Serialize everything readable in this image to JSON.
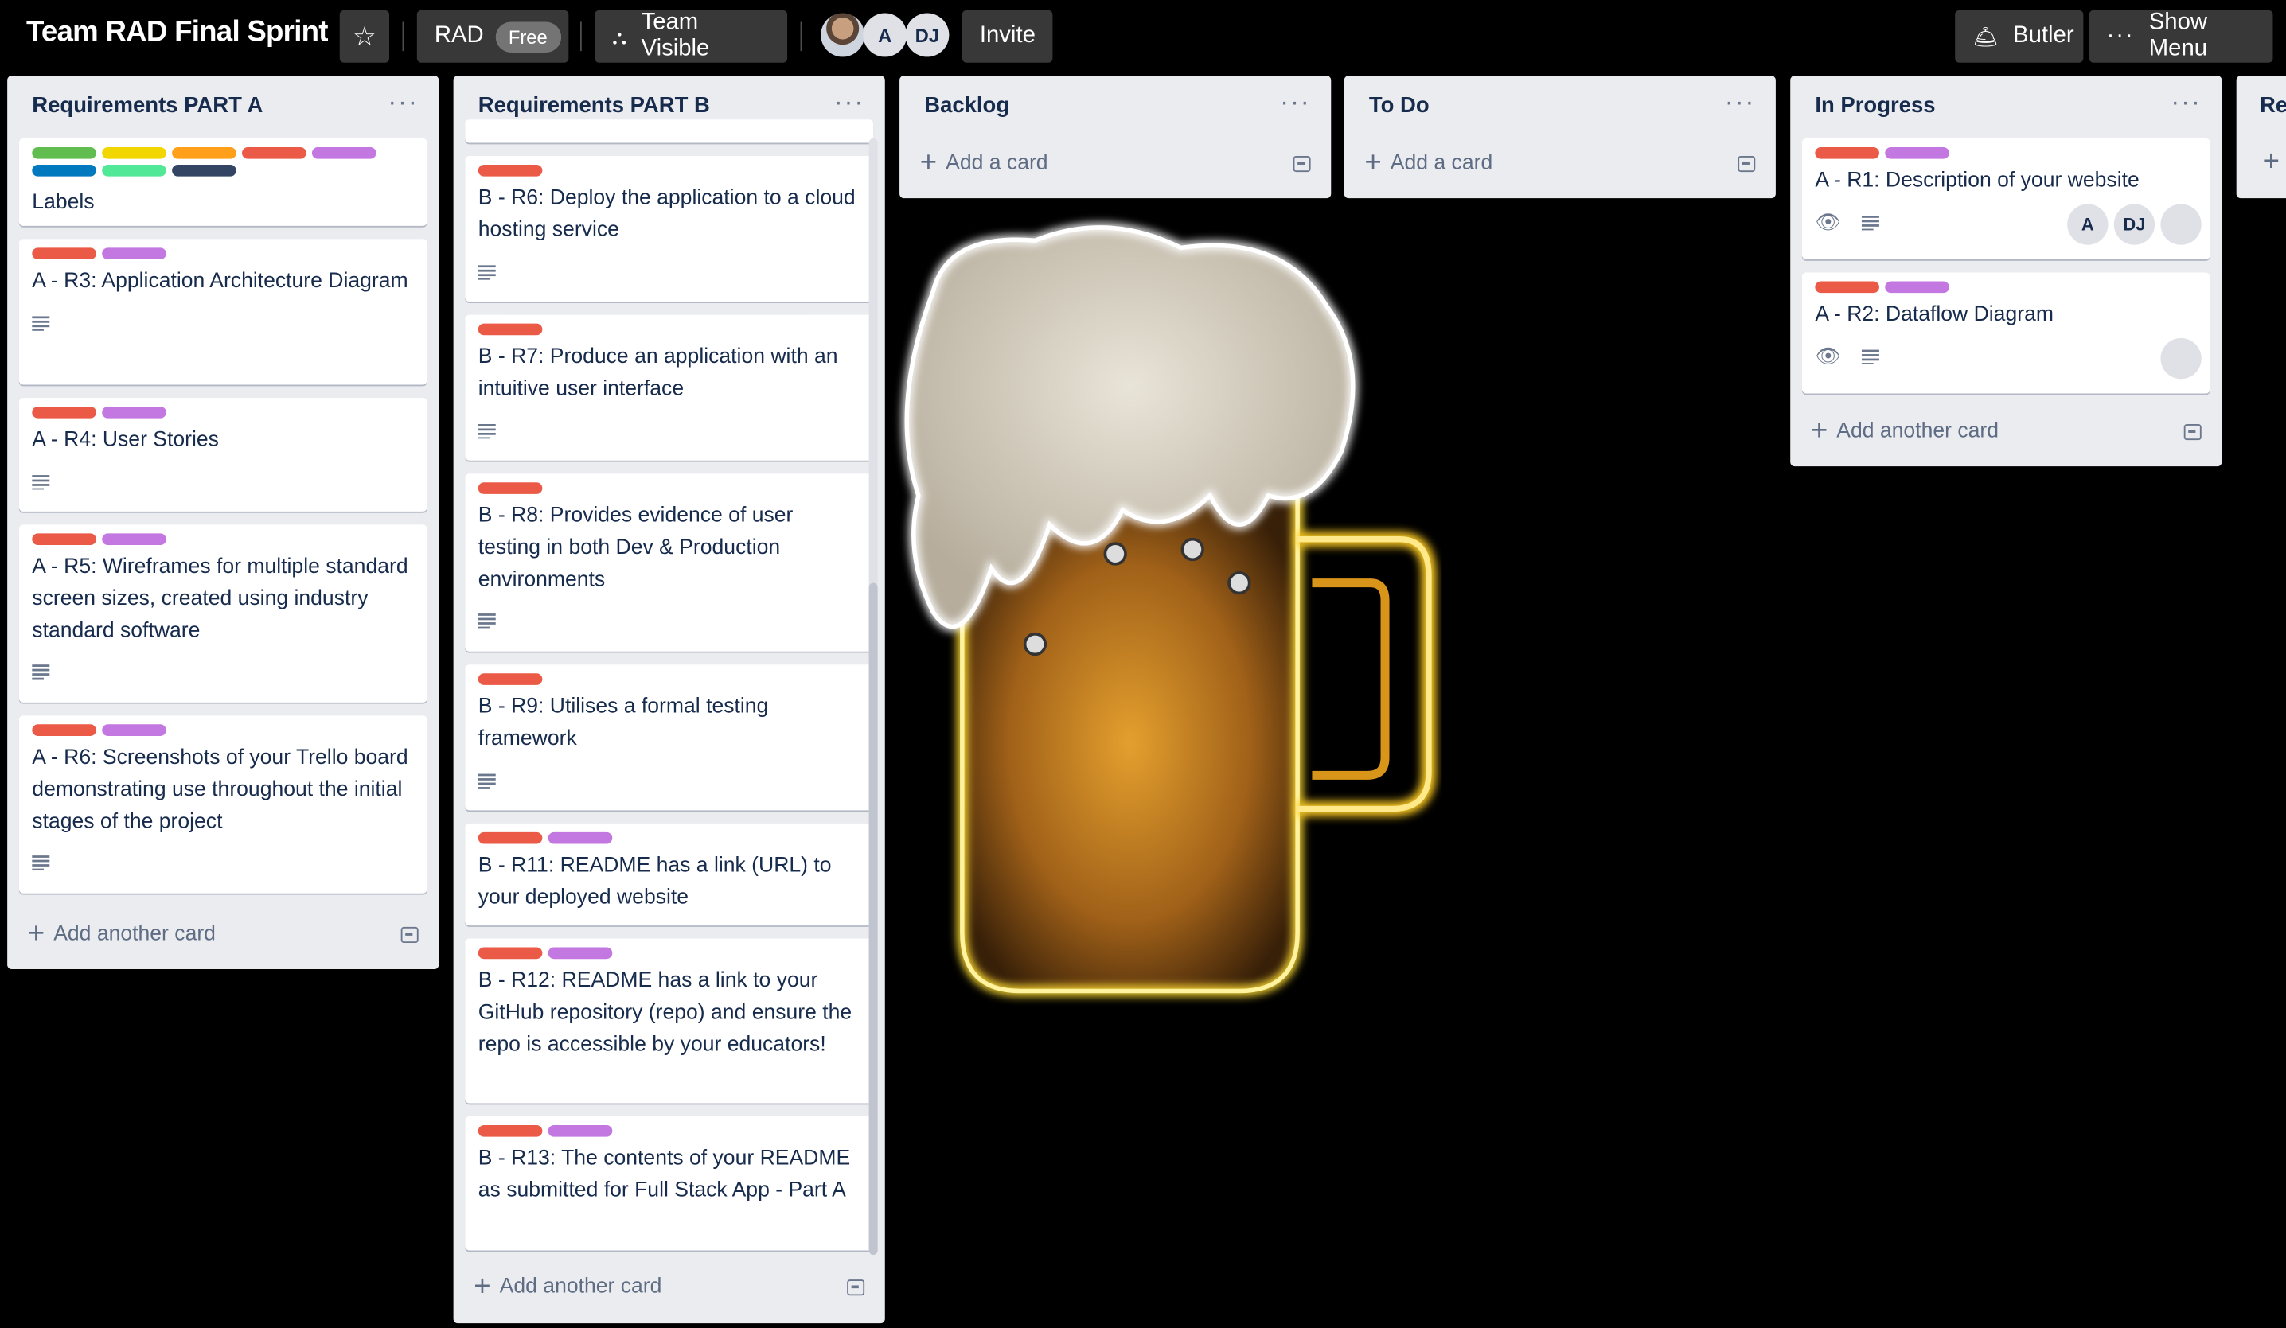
{
  "board": {
    "title": "Team RAD Final Sprint"
  },
  "header": {
    "org_label": "RAD",
    "plan_badge": "Free",
    "visibility_label": "Team Visible",
    "members": [
      "A",
      "DJ"
    ],
    "invite_label": "Invite",
    "butler_label": "Butler",
    "show_menu_label": "Show Menu"
  },
  "colors": {
    "green": "#61bd4f",
    "yellow": "#f2d600",
    "orange": "#ff9f1a",
    "red": "#eb5a46",
    "purple": "#c377e0",
    "blue": "#0079bf",
    "lime": "#51e898",
    "black": "#344563"
  },
  "lists": [
    {
      "title": "Requirements PART A",
      "cards": [
        {
          "title": "Labels"
        },
        {
          "title": "A - R3: Application Architecture Diagram"
        },
        {
          "title": "A - R4: User Stories"
        },
        {
          "title": "A - R5: Wireframes for multiple standard screen sizes, created using industry standard software"
        },
        {
          "title": "A - R6: Screenshots of your Trello board demonstrating use throughout the initial stages of the project"
        }
      ],
      "add_label": "Add another card"
    },
    {
      "title": "Requirements PART B",
      "cards": [
        {
          "title": "B - R6: Deploy the application to a cloud hosting service"
        },
        {
          "title": "B - R7: Produce an application with an intuitive user interface"
        },
        {
          "title": "B - R8: Provides evidence of user testing in both Dev & Production environments"
        },
        {
          "title": "B - R9: Utilises a formal testing framework"
        },
        {
          "title": "B - R11: README has a link (URL) to your deployed website"
        },
        {
          "title": "B - R12: README has a link to your GitHub repository (repo) and ensure the repo is accessible by your educators!"
        },
        {
          "title": "B - R13: The contents of your README as submitted for Full Stack App - Part A"
        }
      ],
      "add_label": "Add another card"
    },
    {
      "title": "Backlog",
      "cards": [],
      "add_label": "Add a card"
    },
    {
      "title": "To Do",
      "cards": [],
      "add_label": "Add a card"
    },
    {
      "title": "In Progress",
      "cards": [
        {
          "title": "A - R1: Description of your website",
          "members": [
            "A",
            "DJ"
          ]
        },
        {
          "title": "A - R2: Dataflow Diagram"
        }
      ],
      "add_label": "Add another card"
    },
    {
      "title": "Re"
    }
  ]
}
